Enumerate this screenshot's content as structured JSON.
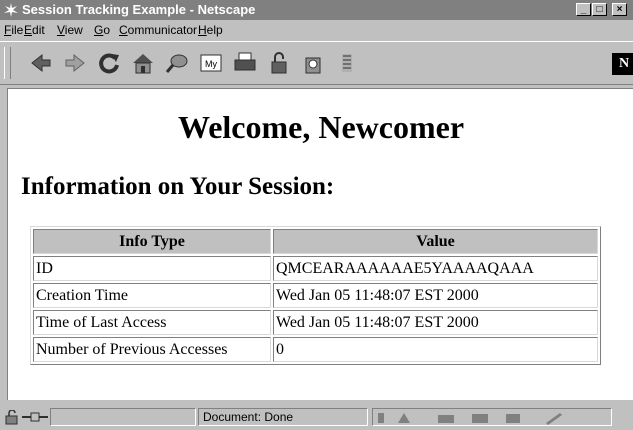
{
  "window": {
    "title": "Session Tracking Example - Netscape"
  },
  "menu": [
    {
      "hot": "F",
      "rest": "ile"
    },
    {
      "hot": "E",
      "rest": "dit"
    },
    {
      "hot": "V",
      "rest": "iew"
    },
    {
      "hot": "G",
      "rest": "o"
    },
    {
      "hot": "C",
      "rest": "ommunicator"
    },
    {
      "hot": "H",
      "rest": "elp"
    }
  ],
  "toolbar": {
    "icons": [
      "back-icon",
      "forward-icon",
      "reload-icon",
      "home-icon",
      "search-icon",
      "my-netscape-icon",
      "print-icon",
      "security-icon",
      "shop-icon",
      "stop-icon"
    ],
    "logo": "N"
  },
  "page": {
    "heading": "Welcome, Newcomer",
    "subheading": "Information on Your Session:",
    "table": {
      "headers": [
        "Info Type",
        "Value"
      ],
      "rows": [
        [
          "ID",
          "QMCEARAAAAAAE5YAAAAQAAA"
        ],
        [
          "Creation Time",
          "Wed Jan 05 11:48:07 EST 2000"
        ],
        [
          "Time of Last Access",
          "Wed Jan 05 11:48:07 EST 2000"
        ],
        [
          "Number of Previous Accesses",
          "0"
        ]
      ]
    }
  },
  "status": {
    "text": "Document: Done"
  }
}
